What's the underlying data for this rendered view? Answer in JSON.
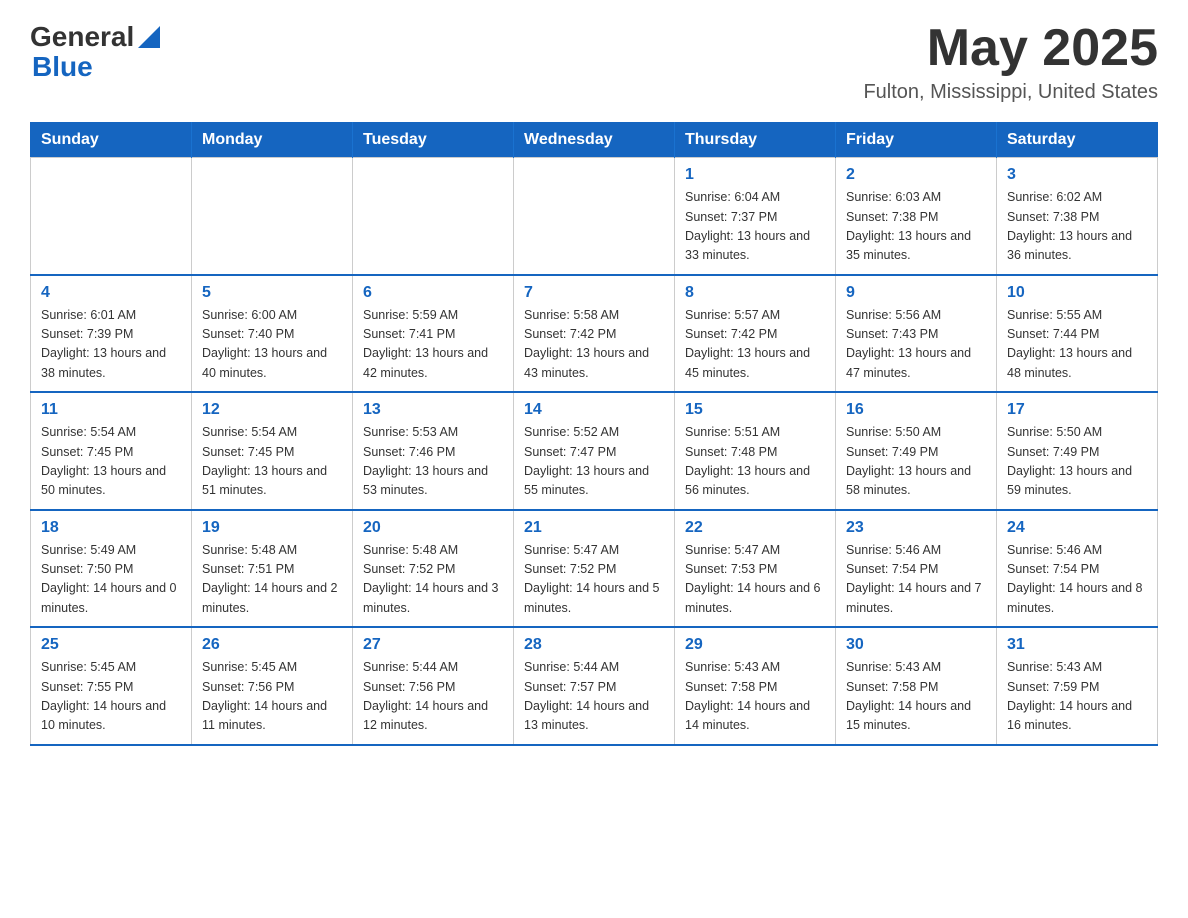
{
  "header": {
    "logo": {
      "general": "General",
      "triangle": "▶",
      "blue": "Blue"
    },
    "month": "May 2025",
    "location": "Fulton, Mississippi, United States"
  },
  "weekdays": [
    "Sunday",
    "Monday",
    "Tuesday",
    "Wednesday",
    "Thursday",
    "Friday",
    "Saturday"
  ],
  "weeks": [
    [
      {
        "day": "",
        "info": ""
      },
      {
        "day": "",
        "info": ""
      },
      {
        "day": "",
        "info": ""
      },
      {
        "day": "",
        "info": ""
      },
      {
        "day": "1",
        "info": "Sunrise: 6:04 AM\nSunset: 7:37 PM\nDaylight: 13 hours and 33 minutes."
      },
      {
        "day": "2",
        "info": "Sunrise: 6:03 AM\nSunset: 7:38 PM\nDaylight: 13 hours and 35 minutes."
      },
      {
        "day": "3",
        "info": "Sunrise: 6:02 AM\nSunset: 7:38 PM\nDaylight: 13 hours and 36 minutes."
      }
    ],
    [
      {
        "day": "4",
        "info": "Sunrise: 6:01 AM\nSunset: 7:39 PM\nDaylight: 13 hours and 38 minutes."
      },
      {
        "day": "5",
        "info": "Sunrise: 6:00 AM\nSunset: 7:40 PM\nDaylight: 13 hours and 40 minutes."
      },
      {
        "day": "6",
        "info": "Sunrise: 5:59 AM\nSunset: 7:41 PM\nDaylight: 13 hours and 42 minutes."
      },
      {
        "day": "7",
        "info": "Sunrise: 5:58 AM\nSunset: 7:42 PM\nDaylight: 13 hours and 43 minutes."
      },
      {
        "day": "8",
        "info": "Sunrise: 5:57 AM\nSunset: 7:42 PM\nDaylight: 13 hours and 45 minutes."
      },
      {
        "day": "9",
        "info": "Sunrise: 5:56 AM\nSunset: 7:43 PM\nDaylight: 13 hours and 47 minutes."
      },
      {
        "day": "10",
        "info": "Sunrise: 5:55 AM\nSunset: 7:44 PM\nDaylight: 13 hours and 48 minutes."
      }
    ],
    [
      {
        "day": "11",
        "info": "Sunrise: 5:54 AM\nSunset: 7:45 PM\nDaylight: 13 hours and 50 minutes."
      },
      {
        "day": "12",
        "info": "Sunrise: 5:54 AM\nSunset: 7:45 PM\nDaylight: 13 hours and 51 minutes."
      },
      {
        "day": "13",
        "info": "Sunrise: 5:53 AM\nSunset: 7:46 PM\nDaylight: 13 hours and 53 minutes."
      },
      {
        "day": "14",
        "info": "Sunrise: 5:52 AM\nSunset: 7:47 PM\nDaylight: 13 hours and 55 minutes."
      },
      {
        "day": "15",
        "info": "Sunrise: 5:51 AM\nSunset: 7:48 PM\nDaylight: 13 hours and 56 minutes."
      },
      {
        "day": "16",
        "info": "Sunrise: 5:50 AM\nSunset: 7:49 PM\nDaylight: 13 hours and 58 minutes."
      },
      {
        "day": "17",
        "info": "Sunrise: 5:50 AM\nSunset: 7:49 PM\nDaylight: 13 hours and 59 minutes."
      }
    ],
    [
      {
        "day": "18",
        "info": "Sunrise: 5:49 AM\nSunset: 7:50 PM\nDaylight: 14 hours and 0 minutes."
      },
      {
        "day": "19",
        "info": "Sunrise: 5:48 AM\nSunset: 7:51 PM\nDaylight: 14 hours and 2 minutes."
      },
      {
        "day": "20",
        "info": "Sunrise: 5:48 AM\nSunset: 7:52 PM\nDaylight: 14 hours and 3 minutes."
      },
      {
        "day": "21",
        "info": "Sunrise: 5:47 AM\nSunset: 7:52 PM\nDaylight: 14 hours and 5 minutes."
      },
      {
        "day": "22",
        "info": "Sunrise: 5:47 AM\nSunset: 7:53 PM\nDaylight: 14 hours and 6 minutes."
      },
      {
        "day": "23",
        "info": "Sunrise: 5:46 AM\nSunset: 7:54 PM\nDaylight: 14 hours and 7 minutes."
      },
      {
        "day": "24",
        "info": "Sunrise: 5:46 AM\nSunset: 7:54 PM\nDaylight: 14 hours and 8 minutes."
      }
    ],
    [
      {
        "day": "25",
        "info": "Sunrise: 5:45 AM\nSunset: 7:55 PM\nDaylight: 14 hours and 10 minutes."
      },
      {
        "day": "26",
        "info": "Sunrise: 5:45 AM\nSunset: 7:56 PM\nDaylight: 14 hours and 11 minutes."
      },
      {
        "day": "27",
        "info": "Sunrise: 5:44 AM\nSunset: 7:56 PM\nDaylight: 14 hours and 12 minutes."
      },
      {
        "day": "28",
        "info": "Sunrise: 5:44 AM\nSunset: 7:57 PM\nDaylight: 14 hours and 13 minutes."
      },
      {
        "day": "29",
        "info": "Sunrise: 5:43 AM\nSunset: 7:58 PM\nDaylight: 14 hours and 14 minutes."
      },
      {
        "day": "30",
        "info": "Sunrise: 5:43 AM\nSunset: 7:58 PM\nDaylight: 14 hours and 15 minutes."
      },
      {
        "day": "31",
        "info": "Sunrise: 5:43 AM\nSunset: 7:59 PM\nDaylight: 14 hours and 16 minutes."
      }
    ]
  ]
}
